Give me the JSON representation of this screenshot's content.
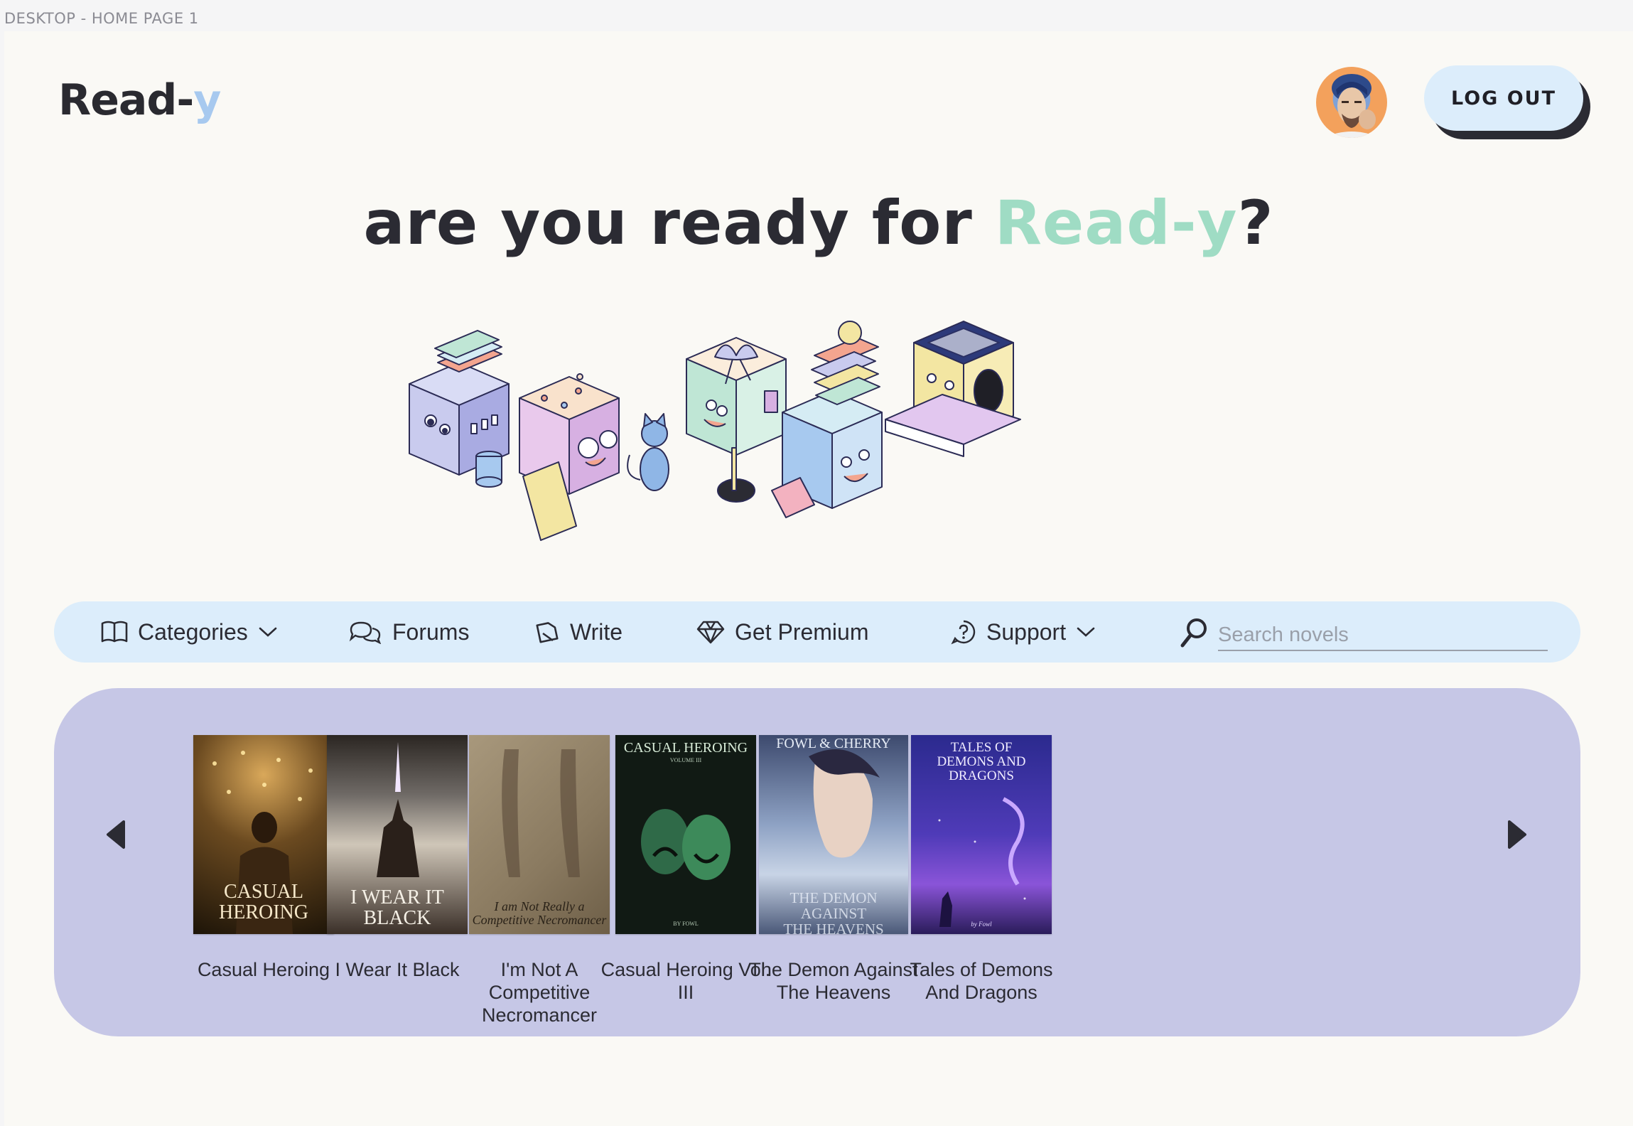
{
  "frame_label": "DESKTOP - HOME PAGE 1",
  "header": {
    "logo_main": "Read-",
    "logo_accent": "y",
    "logout_label": "LOG OUT",
    "colors": {
      "logo_accent": "#a7c9ef",
      "logout_bg": "#dcedfb"
    }
  },
  "hero": {
    "title_prefix": "are you ready for ",
    "title_brand": "Read-y",
    "title_suffix": "?",
    "colors": {
      "brand": "#9fdcc4"
    }
  },
  "nav": {
    "items": [
      {
        "label": "Categories",
        "icon": "book-open-icon",
        "has_dropdown": true
      },
      {
        "label": "Forums",
        "icon": "chat-bubbles-icon",
        "has_dropdown": false
      },
      {
        "label": "Write",
        "icon": "pen-icon",
        "has_dropdown": false
      },
      {
        "label": "Get Premium",
        "icon": "diamond-icon",
        "has_dropdown": false
      },
      {
        "label": "Support",
        "icon": "help-circle-icon",
        "has_dropdown": true
      }
    ],
    "search": {
      "placeholder": "Search novels",
      "value": "",
      "icon": "search-icon"
    },
    "colors": {
      "bg": "#dcedfb"
    }
  },
  "carousel": {
    "colors": {
      "bg": "#c6c7e6"
    },
    "prev_icon": "arrow-left-icon",
    "next_icon": "arrow-right-icon",
    "books": [
      {
        "title": "Casual Heroing",
        "cover_text_top": "",
        "cover_text": "CASUAL\nHEROING"
      },
      {
        "title": "I Wear It Black",
        "cover_text_top": "",
        "cover_text": "I WEAR IT\nBLACK"
      },
      {
        "title": "I'm Not A Competitive Necromancer",
        "cover_text_top": "",
        "cover_text": "I am Not Really a\nCompetitive Necromancer"
      },
      {
        "title": "Casual Heroing Vol. III",
        "cover_text_top": "CASUAL HEROING",
        "cover_sub": "VOLUME III",
        "cover_text": "BY FOWL"
      },
      {
        "title": "The Demon Against The Heavens",
        "cover_text_top": "FOWL & CHERRY",
        "cover_text": "THE DEMON AGAINST\nTHE HEAVENS"
      },
      {
        "title": "Tales of Demons And Dragons",
        "cover_text_top": "TALES OF\nDEMONS AND\nDRAGONS",
        "cover_text": "by Fowl"
      }
    ]
  }
}
